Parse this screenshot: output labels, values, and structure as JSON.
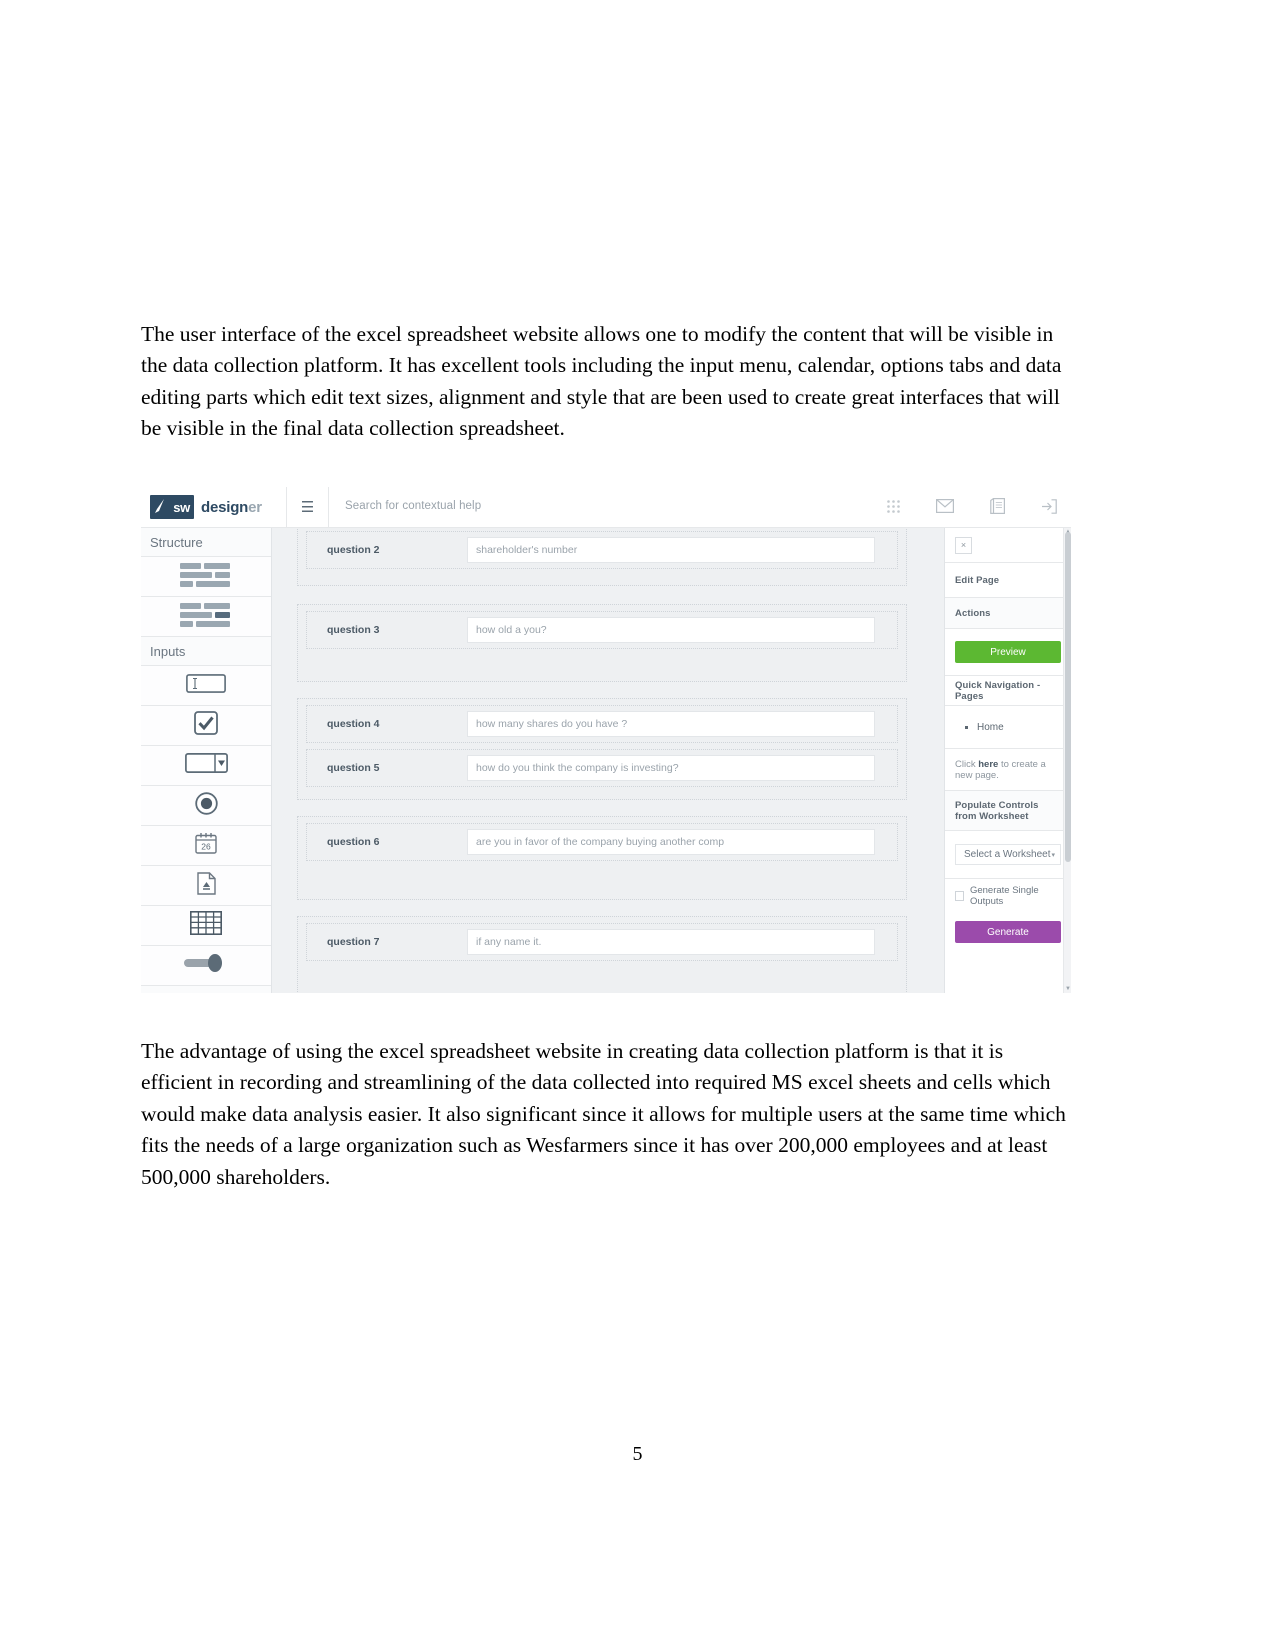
{
  "document": {
    "paragraph_top": "The user interface of the excel spreadsheet website allows one to modify the content that will be visible in the data collection platform. It has excellent tools including the input menu, calendar, options tabs and data editing parts which edit text sizes, alignment and style that are been used to create great interfaces that will be visible in the final data collection spreadsheet.",
    "paragraph_bottom": " The advantage of using the excel spreadsheet website in creating data collection platform is that it is efficient in recording and streamlining of the data collected into required MS excel sheets and cells which would make data analysis easier. It also significant since it allows for multiple users at the same time which fits the needs of a large organization such as Wesfarmers since it has over 200,000 employees and at least 500,000 shareholders.",
    "page_number": "5"
  },
  "app": {
    "logo": {
      "mark_text": "sw",
      "word_main": "design",
      "word_tail": "er",
      "brush_icon": "brush-icon"
    },
    "hamburger_icon": "hamburger-menu-icon",
    "search": {
      "placeholder": "Search for contextual help",
      "value": ""
    },
    "toolbar_icons": [
      {
        "name": "apps-grid-icon",
        "glyph": "grid"
      },
      {
        "name": "mail-envelope-icon",
        "glyph": "envelope"
      },
      {
        "name": "reports-document-icon",
        "glyph": "document"
      },
      {
        "name": "logout-icon",
        "glyph": "logout"
      }
    ],
    "sidebar": {
      "sections": [
        {
          "label": "Structure",
          "items": [
            {
              "name": "layout-two-column-icon",
              "variant": "a"
            },
            {
              "name": "layout-sidebar-icon",
              "variant": "b"
            }
          ]
        },
        {
          "label": "Inputs",
          "items": [
            {
              "name": "text-input-icon"
            },
            {
              "name": "checkbox-icon"
            },
            {
              "name": "dropdown-icon"
            },
            {
              "name": "radio-button-icon"
            },
            {
              "name": "date-picker-icon",
              "day": "26"
            },
            {
              "name": "file-upload-icon"
            },
            {
              "name": "table-grid-icon"
            },
            {
              "name": "slider-icon"
            }
          ]
        }
      ]
    },
    "canvas": {
      "questions": [
        {
          "label": "question 2",
          "value": "shareholder's number"
        },
        {
          "label": "question 3",
          "value": "how old a you?"
        },
        {
          "label": "question 4",
          "value": "how many shares do you have ?"
        },
        {
          "label": "question 5",
          "value": "how do you think the company is investing?"
        },
        {
          "label": "question 6",
          "value": "are you in favor of the company buying another comp"
        },
        {
          "label": "question 7",
          "value": "if any name it."
        }
      ]
    },
    "right_panel": {
      "close_label": "×",
      "edit_page_title": "Edit Page",
      "actions_title": "Actions",
      "preview_label": "Preview",
      "quick_nav_title": "Quick Navigation - Pages",
      "pages": [
        "Home"
      ],
      "new_page_hint_prefix": "Click ",
      "new_page_hint_link": "here",
      "new_page_hint_suffix": " to create a new page.",
      "populate_title": "Populate Controls from Worksheet",
      "worksheet_select_value": "Select a Worksheet",
      "worksheet_caret": "▾",
      "single_outputs_label": "Generate Single Outputs",
      "generate_label": "Generate"
    },
    "colors": {
      "preview_green": "#5cb832",
      "generate_purple": "#9b4bab",
      "brand_navy": "#2e4a63"
    }
  }
}
